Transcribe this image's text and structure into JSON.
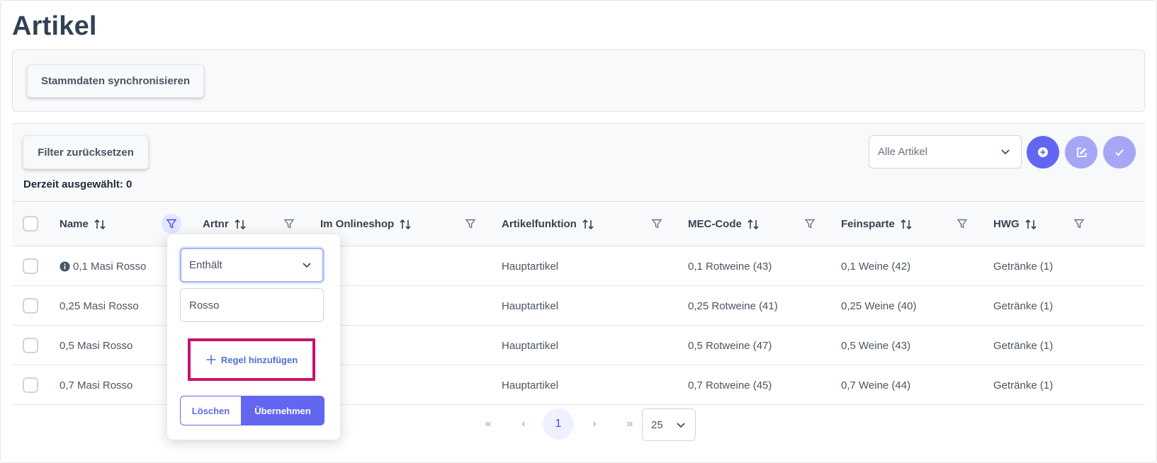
{
  "page": {
    "title": "Artikel"
  },
  "toolbar": {
    "sync_label": "Stammdaten synchronisieren"
  },
  "table_toolbar": {
    "reset_filter_label": "Filter zurücksetzen",
    "selected_count_text": "Derzeit ausgewählt: 0",
    "view_select_value": "Alle Artikel"
  },
  "columns": [
    {
      "label": "Name",
      "filter_active": true
    },
    {
      "label": "Artnr",
      "filter_active": false
    },
    {
      "label": "Im Onlineshop",
      "filter_active": false
    },
    {
      "label": "Artikelfunktion",
      "filter_active": false
    },
    {
      "label": "MEC-Code",
      "filter_active": false
    },
    {
      "label": "Feinsparte",
      "filter_active": false
    },
    {
      "label": "HWG",
      "filter_active": false
    }
  ],
  "rows": [
    {
      "name": "0,1 Masi Rosso",
      "has_info": true,
      "artnr": "",
      "onlineshop": "",
      "funktion": "Hauptartikel",
      "mec": "0,1 Rotweine (43)",
      "feinsparte": "0,1 Weine (42)",
      "hwg": "Getränke (1)"
    },
    {
      "name": "0,25 Masi Rosso",
      "has_info": false,
      "artnr": "",
      "onlineshop": "",
      "funktion": "Hauptartikel",
      "mec": "0,25 Rotweine (41)",
      "feinsparte": "0,25 Weine (40)",
      "hwg": "Getränke (1)"
    },
    {
      "name": "0,5 Masi Rosso",
      "has_info": false,
      "artnr": "",
      "onlineshop": "",
      "funktion": "Hauptartikel",
      "mec": "0,5 Rotweine (47)",
      "feinsparte": "0,5 Weine (43)",
      "hwg": "Getränke (1)"
    },
    {
      "name": "0,7 Masi Rosso",
      "has_info": false,
      "artnr": "",
      "onlineshop": "",
      "funktion": "Hauptartikel",
      "mec": "0,7 Rotweine (45)",
      "feinsparte": "0,7 Weine (44)",
      "hwg": "Getränke (1)"
    }
  ],
  "pagination": {
    "first_label": "«",
    "prev_label": "‹",
    "current_page": "1",
    "next_label": "›",
    "last_label": "»",
    "rows_per_page": "25"
  },
  "filter_popover": {
    "match_mode": "Enthält",
    "value": "Rosso",
    "add_rule_label": "Regel hinzufügen",
    "clear_label": "Löschen",
    "apply_label": "Übernehmen"
  },
  "colors": {
    "primary": "#6366f1",
    "primary_light": "#a5a7f5",
    "highlight": "#c8126e"
  },
  "icons": [
    "sort-icon",
    "filter-icon",
    "chevron-down-icon",
    "plus-circle-icon",
    "edit-icon",
    "check-icon",
    "info-icon",
    "plus-icon"
  ]
}
